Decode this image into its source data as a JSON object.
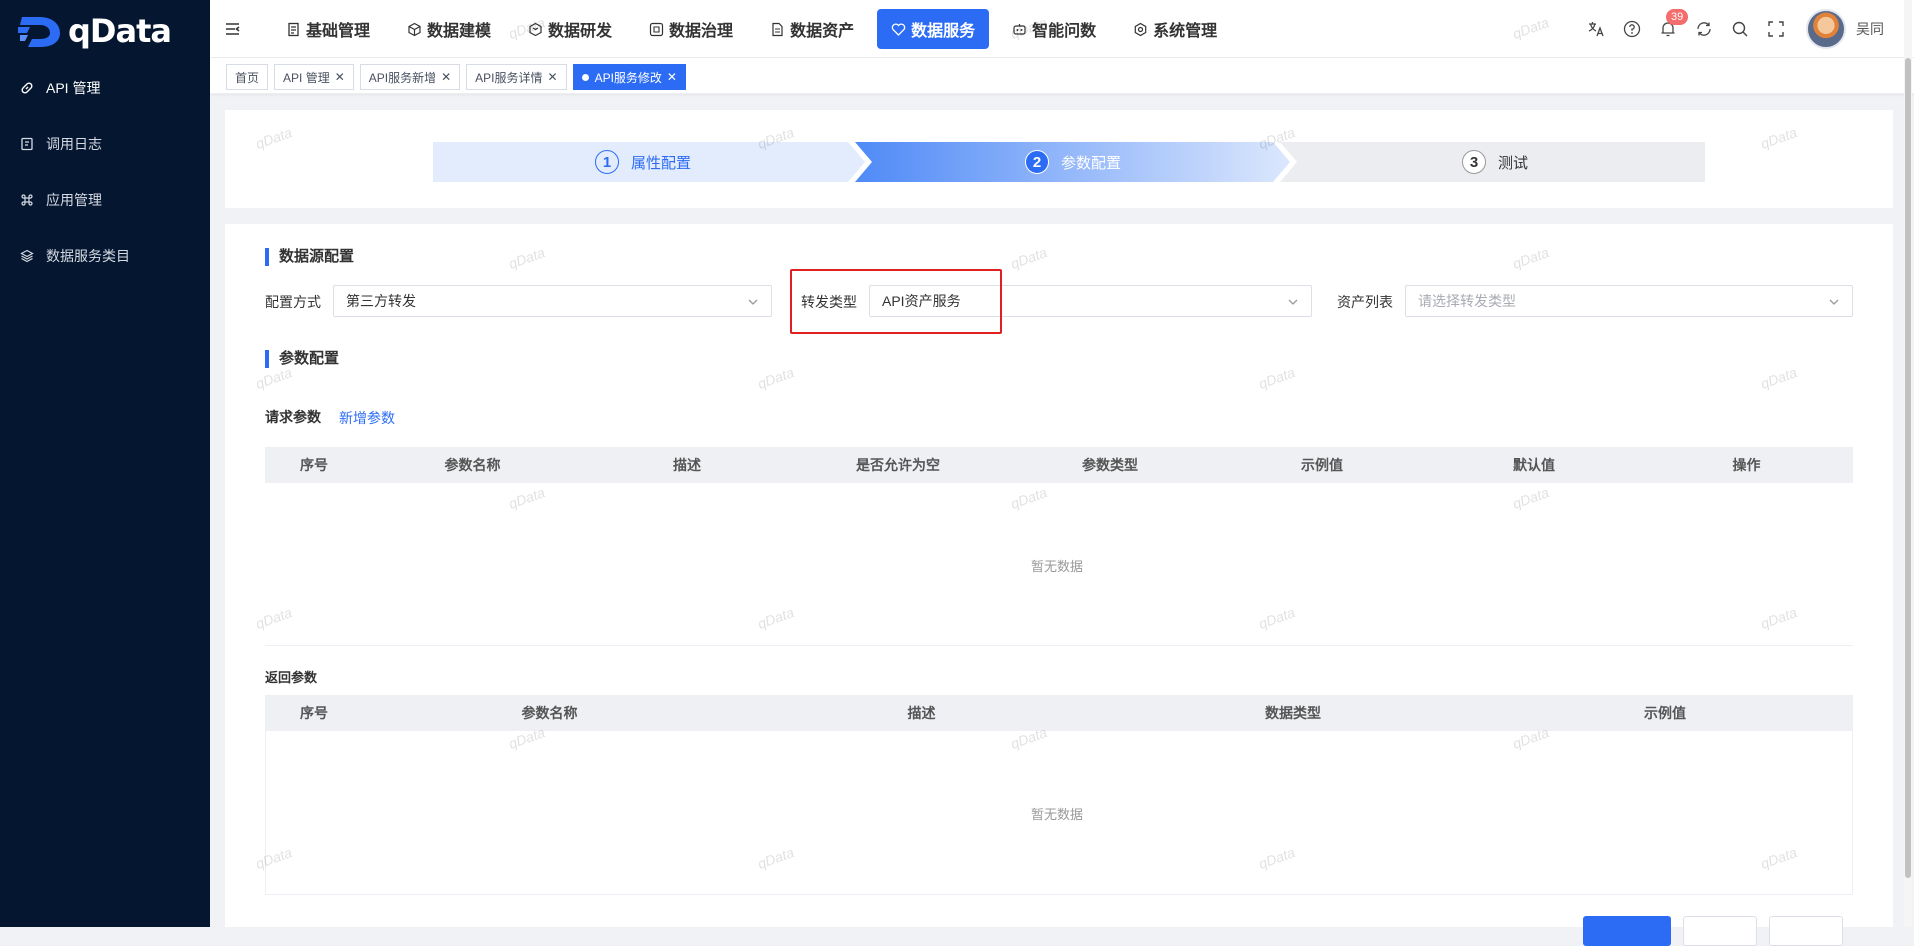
{
  "app": {
    "logo_text": "qData",
    "brand_color": "#2c6cf5",
    "sidebar_bg": "#051630"
  },
  "sidebar": {
    "items": [
      {
        "label": "API 管理",
        "icon": "link-icon",
        "active": true
      },
      {
        "label": "调用日志",
        "icon": "log-icon",
        "active": false
      },
      {
        "label": "应用管理",
        "icon": "command-icon",
        "active": false
      },
      {
        "label": "数据服务类目",
        "icon": "layers-icon",
        "active": false
      }
    ]
  },
  "nav": {
    "items": [
      {
        "label": "基础管理",
        "icon": "document-icon"
      },
      {
        "label": "数据建模",
        "icon": "cube-icon"
      },
      {
        "label": "数据研发",
        "icon": "box-icon"
      },
      {
        "label": "数据治理",
        "icon": "shield-grid-icon"
      },
      {
        "label": "数据资产",
        "icon": "file-icon"
      },
      {
        "label": "数据服务",
        "icon": "heart-icon",
        "active": true
      },
      {
        "label": "智能问数",
        "icon": "robot-icon"
      },
      {
        "label": "系统管理",
        "icon": "gear-icon"
      }
    ]
  },
  "header": {
    "notification_count": "39",
    "username": "吴同"
  },
  "tags": [
    {
      "label": "首页",
      "closable": false
    },
    {
      "label": "API 管理",
      "closable": true
    },
    {
      "label": "API服务新增",
      "closable": true
    },
    {
      "label": "API服务详情",
      "closable": true
    },
    {
      "label": "API服务修改",
      "closable": true,
      "active": true
    }
  ],
  "steps": [
    {
      "num": "1",
      "label": "属性配置",
      "state": "done"
    },
    {
      "num": "2",
      "label": "参数配置",
      "state": "active"
    },
    {
      "num": "3",
      "label": "测试",
      "state": "pending"
    }
  ],
  "datasource": {
    "title": "数据源配置",
    "config_mode_label": "配置方式",
    "config_mode_value": "第三方转发",
    "forward_type_label": "转发类型",
    "forward_type_value": "API资产服务",
    "asset_list_label": "资产列表",
    "asset_list_placeholder": "请选择转发类型"
  },
  "params": {
    "title": "参数配置",
    "request_label": "请求参数",
    "add_param": "新增参数",
    "request_columns": [
      "序号",
      "参数名称",
      "描述",
      "是否允许为空",
      "参数类型",
      "示例值",
      "默认值",
      "操作"
    ],
    "request_empty": "暂无数据",
    "response_label": "返回参数",
    "response_columns": [
      "序号",
      "参数名称",
      "描述",
      "数据类型",
      "示例值"
    ],
    "response_empty": "暂无数据"
  },
  "watermark": "qData"
}
